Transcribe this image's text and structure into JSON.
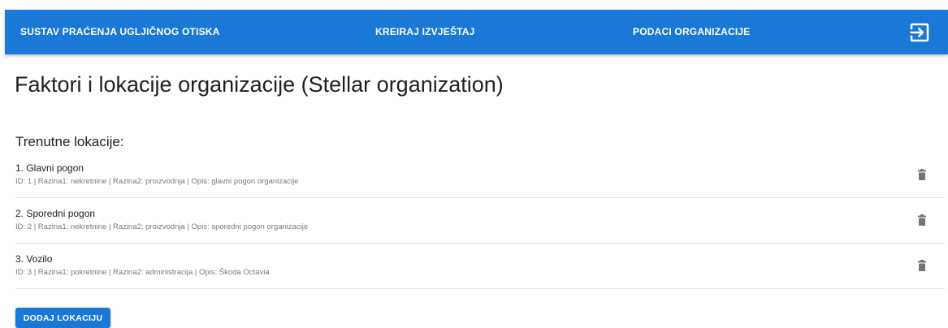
{
  "header": {
    "app_title": "SUSTAV PRAĆENJA UGLJIČNOG OTISKA",
    "nav_report": "KREIRAJ IZVJEŠTAJ",
    "nav_org_data": "PODACI ORGANIZACIJE",
    "logout_icon": "logout-icon",
    "color": "#1a78d6"
  },
  "page": {
    "title": "Faktori i lokacije organizacije (Stellar organization)",
    "section_title": "Trenutne lokacije:"
  },
  "locations": [
    {
      "name": "1. Glavni pogon",
      "details": "ID: 1 | Razina1: nekretnine | Razina2: proizvodnja | Opis: glavni pogon organizacije"
    },
    {
      "name": "2. Sporedni pogon",
      "details": "ID: 2 | Razina1: nekretnine | Razina2: proizvodnja | Opis: sporedni pogon organizacije"
    },
    {
      "name": "3. Vozilo",
      "details": "ID: 3 | Razina1: pokretnine | Razina2: administracija | Opis: Škoda Octavia"
    }
  ],
  "actions": {
    "add_location": "DODAJ LOKACIJU"
  }
}
